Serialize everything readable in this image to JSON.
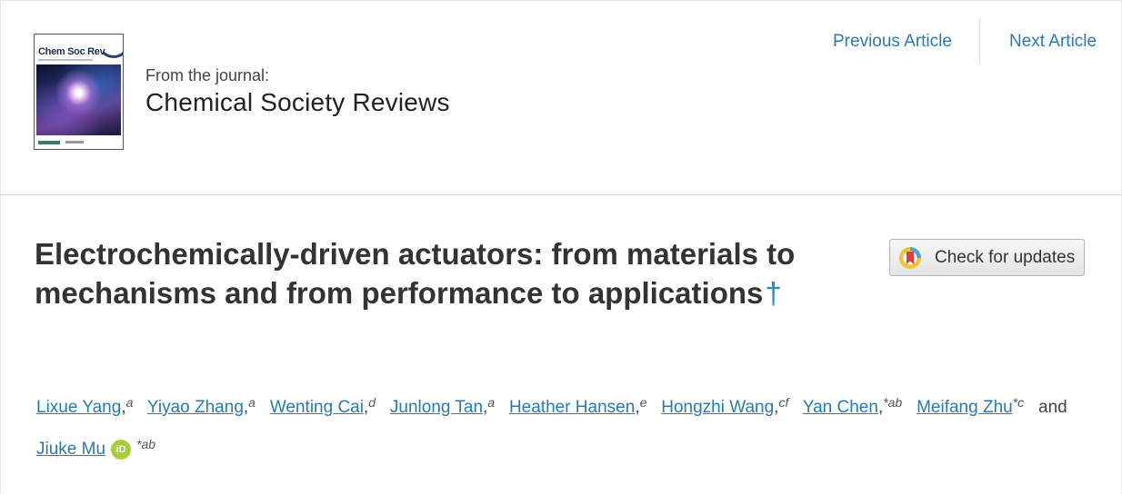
{
  "header": {
    "cover_title": "Chem Soc Rev",
    "from_label": "From the journal:",
    "journal_name": "Chemical Society Reviews",
    "previous_label": "Previous Article",
    "next_label": "Next Article"
  },
  "article": {
    "title": "Electrochemically-driven actuators: from materials to mechanisms and from performance to applications",
    "title_marker": "†",
    "check_updates_label": "Check for updates"
  },
  "authors": [
    {
      "name": "Lixue Yang",
      "sup": "a",
      "sep": ",",
      "corresponding": false
    },
    {
      "name": "Yiyao Zhang",
      "sup": "a",
      "sep": ",",
      "corresponding": false
    },
    {
      "name": "Wenting Cai",
      "sup": "d",
      "sep": ",",
      "corresponding": false
    },
    {
      "name": "Junlong Tan",
      "sup": "a",
      "sep": ",",
      "corresponding": false
    },
    {
      "name": "Heather Hansen",
      "sup": "e",
      "sep": ",",
      "corresponding": false
    },
    {
      "name": "Hongzhi Wang",
      "sup": "cf",
      "sep": ",",
      "corresponding": false
    },
    {
      "name": "Yan Chen",
      "sup": "ab",
      "sep": ",",
      "corresponding": true
    },
    {
      "name": "Meifang Zhu",
      "sup": "c",
      "sep": "",
      "corresponding": true
    }
  ],
  "author_conjunction": "and",
  "last_author": {
    "name": "Jiuke Mu",
    "sup": "ab",
    "corresponding": true,
    "orcid_label": "iD"
  },
  "colors": {
    "link": "#2a7ab0",
    "dagger": "#1f8fbf",
    "orcid": "#a6ce39"
  }
}
